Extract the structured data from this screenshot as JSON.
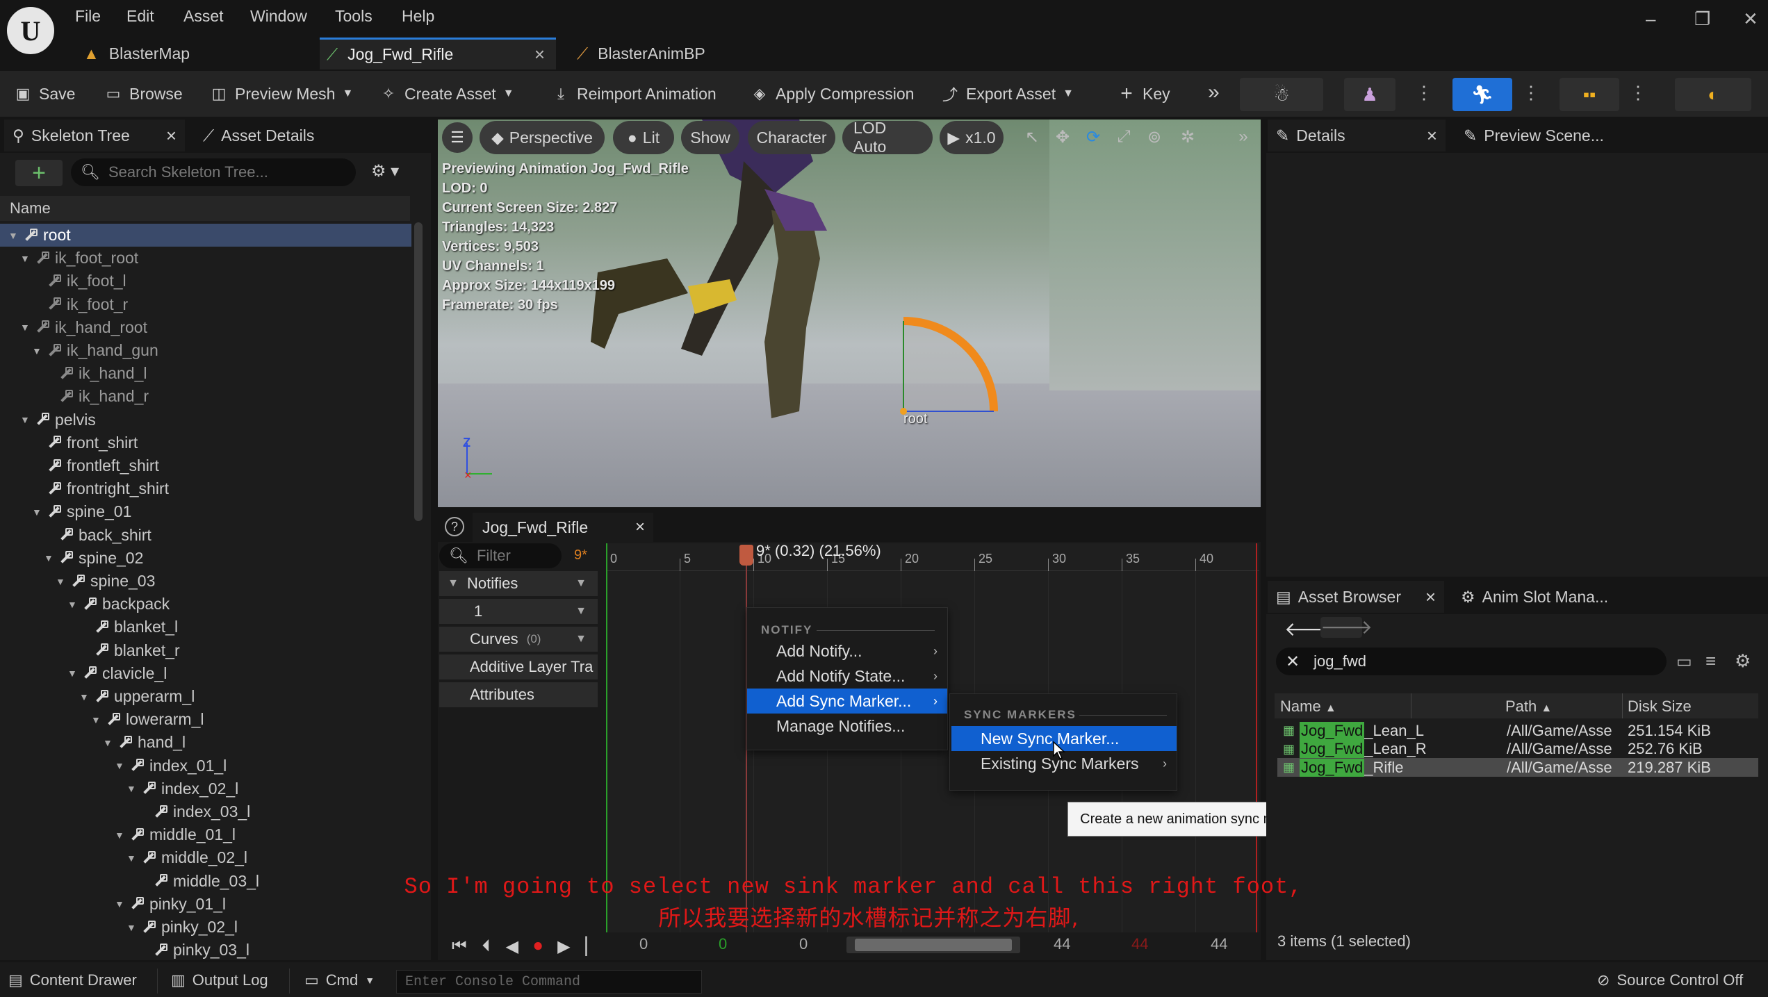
{
  "menu": {
    "items": [
      "File",
      "Edit",
      "Asset",
      "Window",
      "Tools",
      "Help"
    ]
  },
  "doc_tabs": [
    {
      "label": "BlasterMap",
      "icon": "level-icon"
    },
    {
      "label": "Jog_Fwd_Rifle",
      "icon": "animation-sequence-icon",
      "close": "×"
    },
    {
      "label": "BlasterAnimBP",
      "icon": "anim-blueprint-icon"
    }
  ],
  "toolbar": {
    "save": "Save",
    "browse": "Browse",
    "preview_mesh": "Preview Mesh",
    "create_asset": "Create Asset",
    "reimport": "Reimport Animation",
    "apply_compression": "Apply Compression",
    "export_asset": "Export Asset",
    "key": "Key",
    "accent": "#1f6fd6"
  },
  "skeleton_panel": {
    "tab1": "Skeleton Tree",
    "tab1_close": "×",
    "tab2": "Asset Details",
    "search_placeholder": "Search Skeleton Tree...",
    "column": "Name",
    "rows": [
      {
        "label": "root",
        "depth": 0,
        "caret": "▼",
        "virtual": false,
        "selected": true
      },
      {
        "label": "ik_foot_root",
        "depth": 1,
        "caret": "▼",
        "virtual": true
      },
      {
        "label": "ik_foot_l",
        "depth": 2,
        "caret": "",
        "virtual": true
      },
      {
        "label": "ik_foot_r",
        "depth": 2,
        "caret": "",
        "virtual": true
      },
      {
        "label": "ik_hand_root",
        "depth": 1,
        "caret": "▼",
        "virtual": true
      },
      {
        "label": "ik_hand_gun",
        "depth": 2,
        "caret": "▼",
        "virtual": true
      },
      {
        "label": "ik_hand_l",
        "depth": 3,
        "caret": "",
        "virtual": true
      },
      {
        "label": "ik_hand_r",
        "depth": 3,
        "caret": "",
        "virtual": true
      },
      {
        "label": "pelvis",
        "depth": 1,
        "caret": "▼",
        "virtual": false
      },
      {
        "label": "front_shirt",
        "depth": 2,
        "caret": "",
        "virtual": false
      },
      {
        "label": "frontleft_shirt",
        "depth": 2,
        "caret": "",
        "virtual": false
      },
      {
        "label": "frontright_shirt",
        "depth": 2,
        "caret": "",
        "virtual": false
      },
      {
        "label": "spine_01",
        "depth": 2,
        "caret": "▼",
        "virtual": false
      },
      {
        "label": "back_shirt",
        "depth": 3,
        "caret": "",
        "virtual": false
      },
      {
        "label": "spine_02",
        "depth": 3,
        "caret": "▼",
        "virtual": false
      },
      {
        "label": "spine_03",
        "depth": 4,
        "caret": "▼",
        "virtual": false
      },
      {
        "label": "backpack",
        "depth": 5,
        "caret": "▼",
        "virtual": false
      },
      {
        "label": "blanket_l",
        "depth": 6,
        "caret": "",
        "virtual": false
      },
      {
        "label": "blanket_r",
        "depth": 6,
        "caret": "",
        "virtual": false
      },
      {
        "label": "clavicle_l",
        "depth": 5,
        "caret": "▼",
        "virtual": false
      },
      {
        "label": "upperarm_l",
        "depth": 6,
        "caret": "▼",
        "virtual": false
      },
      {
        "label": "lowerarm_l",
        "depth": 7,
        "caret": "▼",
        "virtual": false
      },
      {
        "label": "hand_l",
        "depth": 8,
        "caret": "▼",
        "virtual": false
      },
      {
        "label": "index_01_l",
        "depth": 9,
        "caret": "▼",
        "virtual": false
      },
      {
        "label": "index_02_l",
        "depth": 10,
        "caret": "▼",
        "virtual": false
      },
      {
        "label": "index_03_l",
        "depth": 11,
        "caret": "",
        "virtual": false
      },
      {
        "label": "middle_01_l",
        "depth": 9,
        "caret": "▼",
        "virtual": false
      },
      {
        "label": "middle_02_l",
        "depth": 10,
        "caret": "▼",
        "virtual": false
      },
      {
        "label": "middle_03_l",
        "depth": 11,
        "caret": "",
        "virtual": false
      },
      {
        "label": "pinky_01_l",
        "depth": 9,
        "caret": "▼",
        "virtual": false
      },
      {
        "label": "pinky_02_l",
        "depth": 10,
        "caret": "▼",
        "virtual": false
      },
      {
        "label": "pinky_03_l",
        "depth": 11,
        "caret": "",
        "virtual": false
      }
    ]
  },
  "viewport": {
    "perspective": "Perspective",
    "lit": "Lit",
    "show": "Show",
    "character": "Character",
    "lod": "LOD Auto",
    "speed": "x1.0",
    "stats": [
      "Previewing Animation Jog_Fwd_Rifle",
      "LOD: 0",
      "Current Screen Size: 2.827",
      "Triangles: 14,323",
      "Vertices: 9,503",
      "UV Channels: 1",
      "Approx Size: 144x119x199",
      "Framerate: 30 fps"
    ],
    "bone_label": "root",
    "axis_z": "Z"
  },
  "sequencer": {
    "tab": "Jog_Fwd_Rifle",
    "tab_close": "×",
    "filter_placeholder": "Filter",
    "frame_badge": "9*",
    "playhead_label": "9* (0.32) (21.56%)",
    "ruler": [
      "0",
      "5",
      "10",
      "15",
      "20",
      "25",
      "30",
      "35",
      "40"
    ],
    "rows": {
      "notifies": "Notifies",
      "track1": "1",
      "curves": "Curves",
      "curves_count": "(0)",
      "additive": "Additive Layer Tra",
      "attributes": "Attributes"
    },
    "transport": {
      "start": "0",
      "green": "0",
      "current": "0",
      "end": "44",
      "red": "44",
      "end2": "44"
    }
  },
  "context_menu": {
    "header": "NOTIFY",
    "items": [
      "Add Notify...",
      "Add Notify State...",
      "Add Sync Marker...",
      "Manage Notifies..."
    ],
    "sub_header": "SYNC MARKERS",
    "sub_items": [
      "New Sync Marker...",
      "Existing Sync Markers"
    ],
    "tooltip": "Create a new animation sync marker"
  },
  "details_panel": {
    "tab1": "Details",
    "tab1_close": "×",
    "tab2": "Preview Scene..."
  },
  "asset_browser": {
    "tab1": "Asset Browser",
    "tab1_close": "×",
    "tab2": "Anim Slot Mana...",
    "search": "jog_fwd",
    "columns": [
      "Name",
      "Path",
      "Disk Size"
    ],
    "rows": [
      {
        "hl": "Jog_Fwd",
        "rest": "_Lean_L",
        "path": "/All/Game/Asse",
        "size": "251.154 KiB",
        "selected": false
      },
      {
        "hl": "Jog_Fwd",
        "rest": "_Lean_R",
        "path": "/All/Game/Asse",
        "size": "252.76 KiB",
        "selected": false
      },
      {
        "hl": "Jog_Fwd",
        "rest": "_Rifle",
        "path": "/All/Game/Asse",
        "size": "219.287 KiB",
        "selected": true
      }
    ],
    "status": "3 items (1 selected)",
    "highlight_color": "#3fa83f"
  },
  "subtitles": {
    "en": "So I'm going to select new sink marker and call this right foot,",
    "zh": "所以我要选择新的水槽标记并称之为右脚,"
  },
  "bottom_bar": {
    "content_drawer": "Content Drawer",
    "output_log": "Output Log",
    "cmd": "Cmd",
    "console_placeholder": "Enter Console Command",
    "source_control": "Source Control Off"
  }
}
